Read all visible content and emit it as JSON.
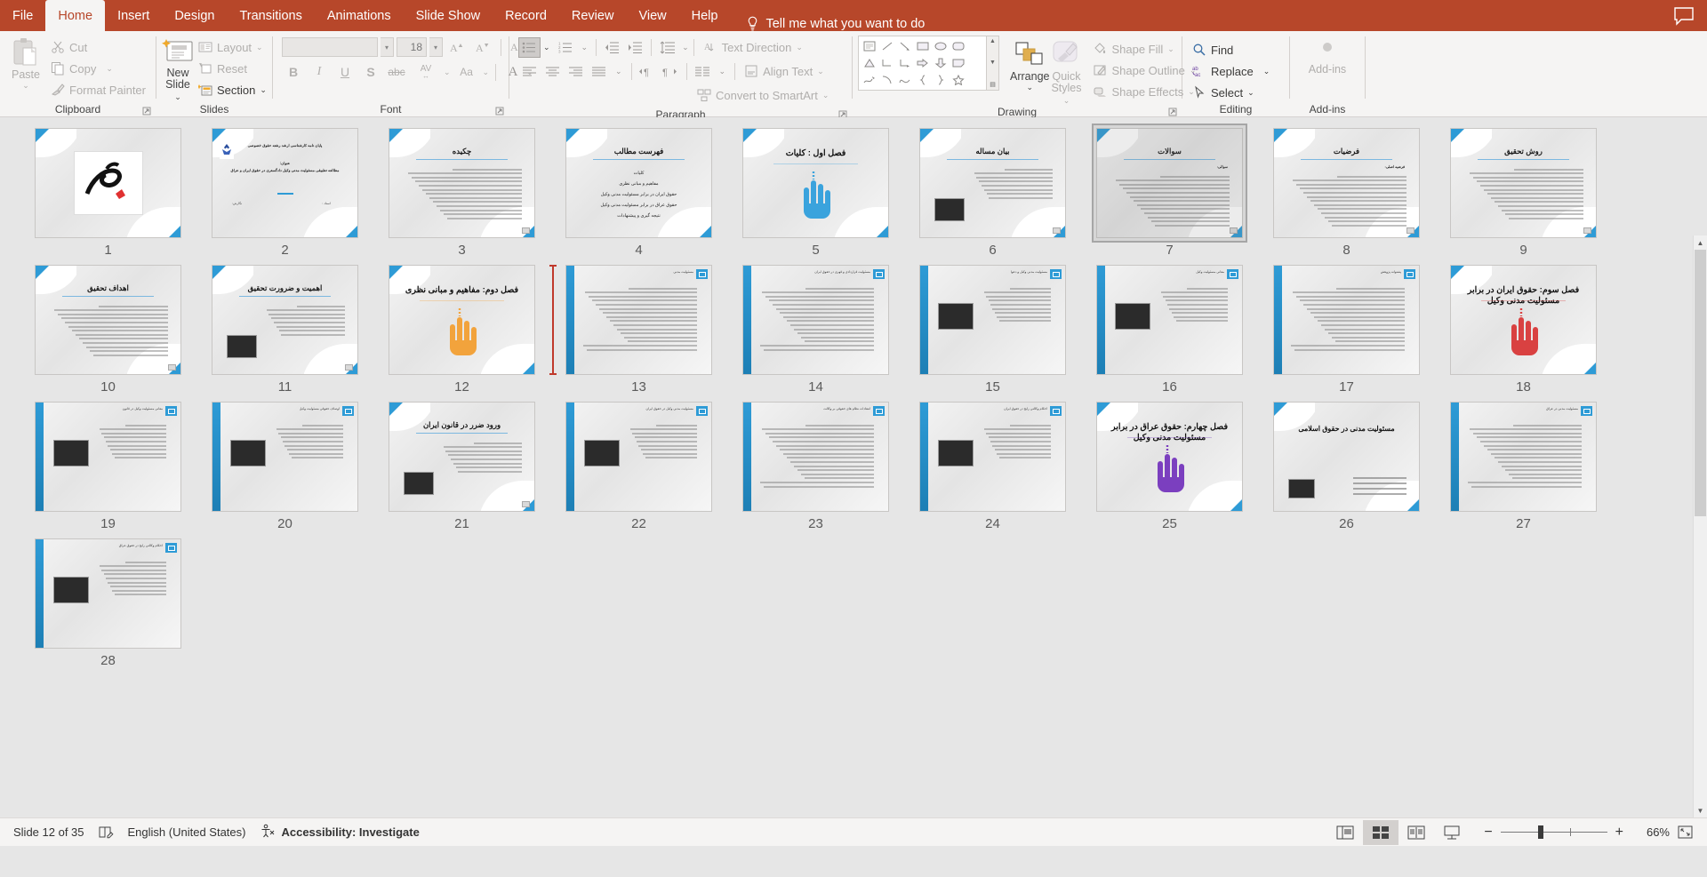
{
  "app": {
    "tabs": [
      {
        "label": "File",
        "active": false
      },
      {
        "label": "Home",
        "active": true
      },
      {
        "label": "Insert",
        "active": false
      },
      {
        "label": "Design",
        "active": false
      },
      {
        "label": "Transitions",
        "active": false
      },
      {
        "label": "Animations",
        "active": false
      },
      {
        "label": "Slide Show",
        "active": false
      },
      {
        "label": "Record",
        "active": false
      },
      {
        "label": "Review",
        "active": false
      },
      {
        "label": "View",
        "active": false
      },
      {
        "label": "Help",
        "active": false
      }
    ],
    "tell_me": "Tell me what you want to do",
    "comment_icon": "comment-icon"
  },
  "ribbon": {
    "clipboard": {
      "label": "Clipboard",
      "paste": "Paste",
      "cut": "Cut",
      "copy": "Copy",
      "format_painter": "Format Painter"
    },
    "slides": {
      "label": "Slides",
      "new_slide_line1": "New",
      "new_slide_line2": "Slide",
      "layout": "Layout",
      "reset": "Reset",
      "section": "Section"
    },
    "font": {
      "label": "Font",
      "font_name": "",
      "font_size": "18",
      "bold": "B",
      "italic": "I",
      "underline": "U",
      "shadow": "S",
      "strikethrough": "abc",
      "char_spacing": "AV",
      "change_case": "Aa",
      "font_color": "A"
    },
    "paragraph": {
      "label": "Paragraph",
      "text_direction": "Text Direction",
      "align_text": "Align Text",
      "convert_smartart": "Convert to SmartArt"
    },
    "drawing": {
      "label": "Drawing",
      "arrange": "Arrange",
      "quick_styles_line1": "Quick",
      "quick_styles_line2": "Styles",
      "shape_fill": "Shape Fill",
      "shape_outline": "Shape Outline",
      "shape_effects": "Shape Effects"
    },
    "editing": {
      "label": "Editing",
      "find": "Find",
      "replace": "Replace",
      "select": "Select"
    },
    "addins": {
      "label": "Add-ins",
      "button": "Add-ins"
    }
  },
  "status": {
    "slide_counter": "Slide 12 of 35",
    "language": "English (United States)",
    "accessibility": "Accessibility: Investigate",
    "zoom_percent": "66%",
    "views": [
      {
        "name": "normal-view",
        "active": false
      },
      {
        "name": "slide-sorter-view",
        "active": true
      },
      {
        "name": "reading-view",
        "active": false
      },
      {
        "name": "slide-show-view",
        "active": false
      }
    ],
    "zoom_out": "−",
    "zoom_in": "+",
    "fit_to_window": "fit-slide-to-window-icon"
  },
  "sorter": {
    "selected_slide": 7,
    "insertion_after_slide": 12,
    "slides": [
      {
        "n": 1,
        "kind": "logo",
        "title": ""
      },
      {
        "n": 2,
        "kind": "cover",
        "title": "پایان نامه کارشناسی ارشد رشته حقوق خصوصی",
        "subtitle_label": "عنوان:",
        "subtitle": "مطالعه تطبیقی مسئولیت مدنی وکیل دادگستری در حقوق ایران و عراق",
        "meta_left": "نگارش:",
        "meta_right": "استاد :"
      },
      {
        "n": 3,
        "kind": "content",
        "title": "چکیده"
      },
      {
        "n": 4,
        "kind": "toc",
        "title": "فهرست مطالب",
        "items": [
          "کلیات",
          "مفاهیم و مبانی نظری",
          "حقوق ایران در برابر مسئولیت مدنی وکیل",
          "حقوق عراق در برابر مسئولیت مدنی وکیل",
          "نتیجه گیری و پیشنهادات"
        ]
      },
      {
        "n": 5,
        "kind": "section",
        "title": "فصل اول : کلیات",
        "hand": "#3aa3dd"
      },
      {
        "n": 6,
        "kind": "content",
        "title": "بیان مساله",
        "photo": true
      },
      {
        "n": 7,
        "kind": "content",
        "title": "سوالات",
        "sublabel": "سوالی:"
      },
      {
        "n": 8,
        "kind": "content",
        "title": "فرضیات",
        "sublabel": "فرضیه اصلی:"
      },
      {
        "n": 9,
        "kind": "content",
        "title": "روش تحقیق"
      },
      {
        "n": 10,
        "kind": "content",
        "title": "اهداف تحقیق"
      },
      {
        "n": 11,
        "kind": "content",
        "title": "اهمیت و ضرورت تحقیق",
        "photo": true
      },
      {
        "n": 12,
        "kind": "section",
        "title": "فصل دوم: مفاهیم و مبانی نظری",
        "hand": "#f2a33c"
      },
      {
        "n": 13,
        "kind": "sidebar",
        "title": "مسئولیت مدنی",
        "header": "مسئولیت مدنی"
      },
      {
        "n": 14,
        "kind": "sidebar",
        "title": "",
        "header": "مسئولیت قراردادی و قهری در حقوق ایران"
      },
      {
        "n": 15,
        "kind": "sidebar",
        "title": "",
        "header": "مسئولیت مدنی وکیل و دعوا",
        "photo": true
      },
      {
        "n": 16,
        "kind": "sidebar",
        "title": "",
        "header": "معانی مسئولیت وکیل",
        "photo": true
      },
      {
        "n": 17,
        "kind": "sidebar",
        "title": "پشتوانه پژوهش",
        "header": "پشتوانه پژوهش"
      },
      {
        "n": 18,
        "kind": "section",
        "title": "فصل سوم: حقوق ایران در برابر مسئولیت مدنی وکیل",
        "hand": "#d94141"
      },
      {
        "n": 19,
        "kind": "sidebar",
        "title": "",
        "header": "معانی مسئولیت وکیل در قانون",
        "photo": true
      },
      {
        "n": 20,
        "kind": "sidebar",
        "title": "",
        "header": "اوصاف حقوقی مسئولیت وکیل",
        "photo": true
      },
      {
        "n": 21,
        "kind": "content",
        "title": "ورود ضرر در قانون ایران",
        "photo": true
      },
      {
        "n": 22,
        "kind": "sidebar",
        "title": "",
        "header": "مسئولیت مدنی وکیل در حقوق ایران",
        "photo": true
      },
      {
        "n": 23,
        "kind": "sidebar",
        "title": "",
        "header": "انتقادات نظام های حقوقی بر وکالت"
      },
      {
        "n": 24,
        "kind": "sidebar",
        "title": "",
        "header": "احکام وکالتی رایج در حقوق ایران",
        "photo": true
      },
      {
        "n": 25,
        "kind": "section",
        "title": "فصل چهارم: حقوق عراق در برابر مسئولیت مدنی وکیل",
        "hand": "#7b3fbf"
      },
      {
        "n": 26,
        "kind": "titlebox",
        "title": "مسئولیت مدنی در حقوق اسلامی",
        "photo": true
      },
      {
        "n": 27,
        "kind": "sidebar",
        "title": "",
        "header": "مسئولیت مدنی در عراق"
      },
      {
        "n": 28,
        "kind": "sidebar",
        "title": "",
        "header": "احکام وکالتی رایج در حقوق عراق",
        "photo": true
      }
    ]
  }
}
